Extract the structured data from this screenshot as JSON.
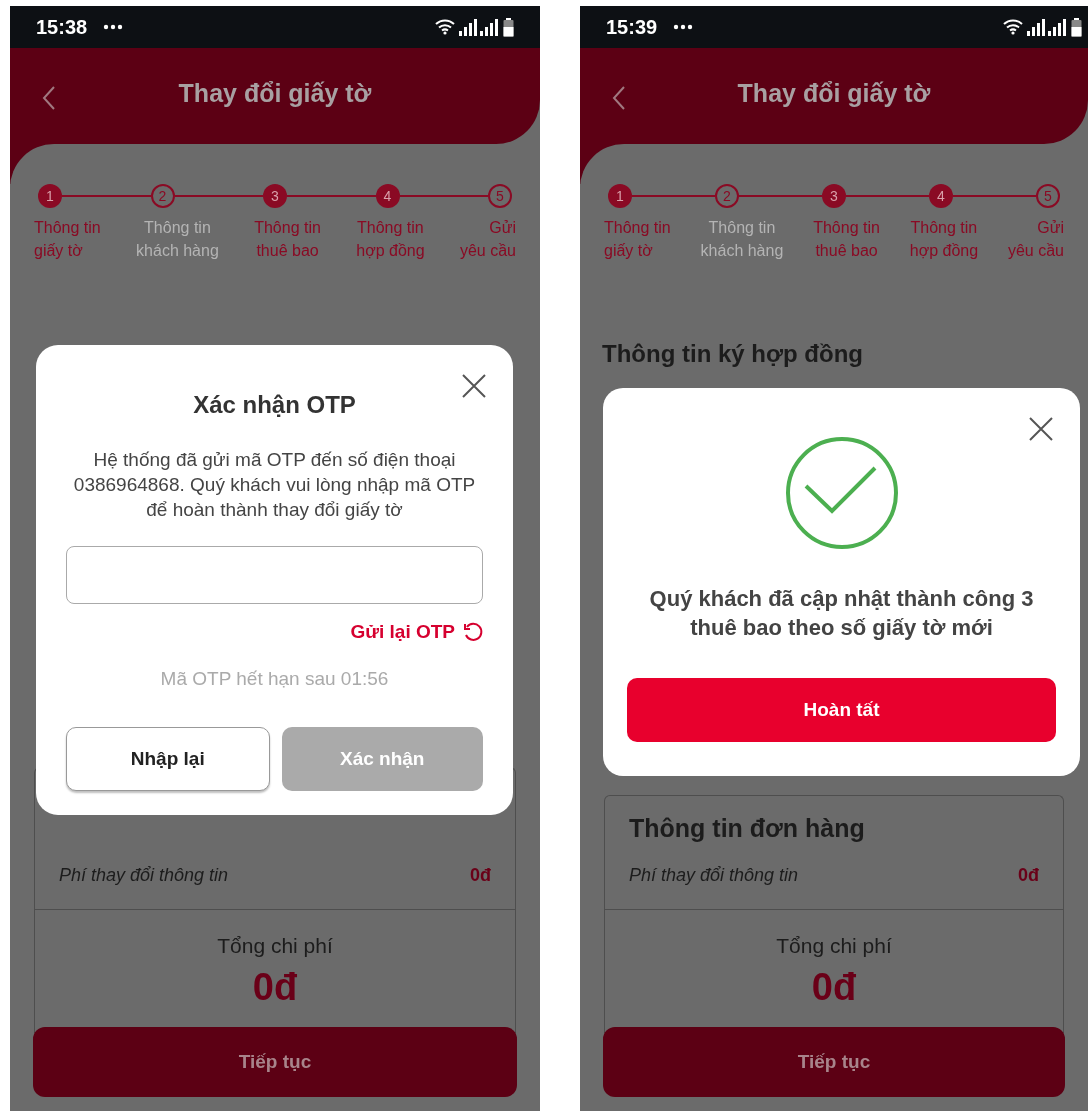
{
  "phones": [
    {
      "status_bar": {
        "time": "15:38"
      },
      "header": {
        "title": "Thay đổi giấy tờ"
      },
      "steps": [
        {
          "number": "1",
          "label": "Thông tin\ngiấy tờ",
          "completed": true,
          "disabled": false
        },
        {
          "number": "2",
          "label": "Thông tin\nkhách hàng",
          "completed": false,
          "disabled": true
        },
        {
          "number": "3",
          "label": "Thông tin\nthuê bao",
          "completed": true,
          "disabled": false
        },
        {
          "number": "4",
          "label": "Thông tin\nhợp đồng",
          "completed": true,
          "disabled": false
        },
        {
          "number": "5",
          "label": "Gửi\nyêu cầu",
          "completed": false,
          "disabled": false
        }
      ],
      "order": {
        "fee_label": "Phí thay đổi thông tin",
        "fee_value": "0đ",
        "total_label": "Tổng chi phí",
        "total_value": "0đ"
      },
      "continue_button": "Tiếp tục",
      "dialog": {
        "kind": "otp",
        "title": "Xác nhận OTP",
        "message": "Hệ thống đã gửi mã OTP đến số điện thoại 0386964868. Quý khách vui lòng nhập mã OTP để hoàn thành thay đổi giấy tờ",
        "resend_link": "Gửi lại OTP",
        "timer": "Mã OTP hết hạn sau 01:56",
        "buttons": [
          {
            "label": "Nhập lại",
            "kind": "outline"
          },
          {
            "label": "Xác nhận",
            "kind": "primary",
            "disabled": true
          }
        ]
      }
    },
    {
      "status_bar": {
        "time": "15:39"
      },
      "header": {
        "title": "Thay đổi giấy tờ"
      },
      "steps": [
        {
          "number": "1",
          "label": "Thông tin\ngiấy tờ",
          "completed": true,
          "disabled": false
        },
        {
          "number": "2",
          "label": "Thông tin\nkhách hàng",
          "completed": false,
          "disabled": true
        },
        {
          "number": "3",
          "label": "Thông tin\nthuê bao",
          "completed": true,
          "disabled": false
        },
        {
          "number": "4",
          "label": "Thông tin\nhợp đồng",
          "completed": true,
          "disabled": false
        },
        {
          "number": "5",
          "label": "Gửi\nyêu cầu",
          "completed": false,
          "disabled": false
        }
      ],
      "section_title": "Thông tin ký hợp đồng",
      "order": {
        "title": "Thông tin đơn hàng",
        "fee_label": "Phí thay đổi thông tin",
        "fee_value": "0đ",
        "total_label": "Tổng chi phí",
        "total_value": "0đ"
      },
      "continue_button": "Tiếp tục",
      "dialog": {
        "kind": "success",
        "message": "Quý khách đã cập nhật thành công 3 thuê bao theo số giấy tờ mới",
        "buttons": [
          {
            "label": "Hoàn tất",
            "kind": "primary",
            "disabled": false
          }
        ]
      }
    }
  ]
}
